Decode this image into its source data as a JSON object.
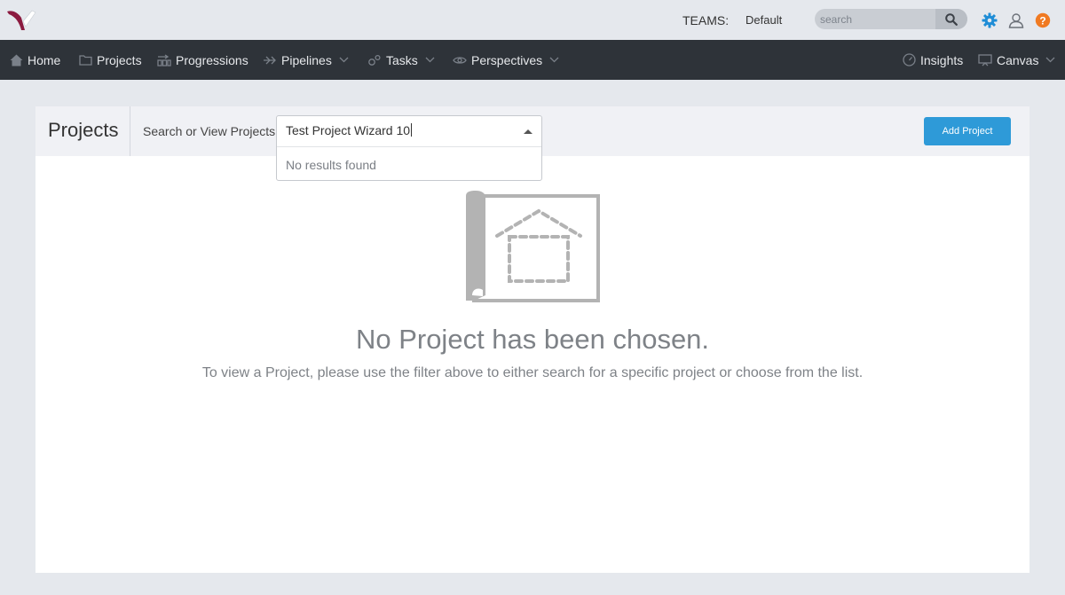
{
  "topbar": {
    "teams_label": "TEAMS:",
    "teams_value": "Default",
    "search_placeholder": "search",
    "icons": [
      "logo",
      "search-icon",
      "gear-icon",
      "user-icon",
      "help-icon"
    ],
    "colors": {
      "gear": "#1f8dd6",
      "help": "#f07a22",
      "logo": "#8b1a3f"
    }
  },
  "nav": {
    "items": [
      {
        "label": "Home",
        "icon": "home-icon"
      },
      {
        "label": "Projects",
        "icon": "folder-icon"
      },
      {
        "label": "Progressions",
        "icon": "progressions-icon"
      },
      {
        "label": "Pipelines",
        "icon": "pipelines-icon",
        "dropdown": true
      },
      {
        "label": "Tasks",
        "icon": "tasks-icon",
        "dropdown": true
      },
      {
        "label": "Perspectives",
        "icon": "eye-icon",
        "dropdown": true
      },
      {
        "label": "Insights",
        "icon": "gauge-icon"
      },
      {
        "label": "Canvas",
        "icon": "canvas-icon",
        "dropdown": true
      }
    ]
  },
  "panel": {
    "title": "Projects",
    "filter_label": "Search or View Projects:",
    "filter_value": "Test Project Wizard 10",
    "no_results": "No results found",
    "add_button": "Add Project",
    "add_button_color": "#2e9ad8"
  },
  "empty_state": {
    "title": "No Project has been chosen.",
    "description": "To view a Project, please use the filter above to either search for a specific project or choose from the list."
  }
}
